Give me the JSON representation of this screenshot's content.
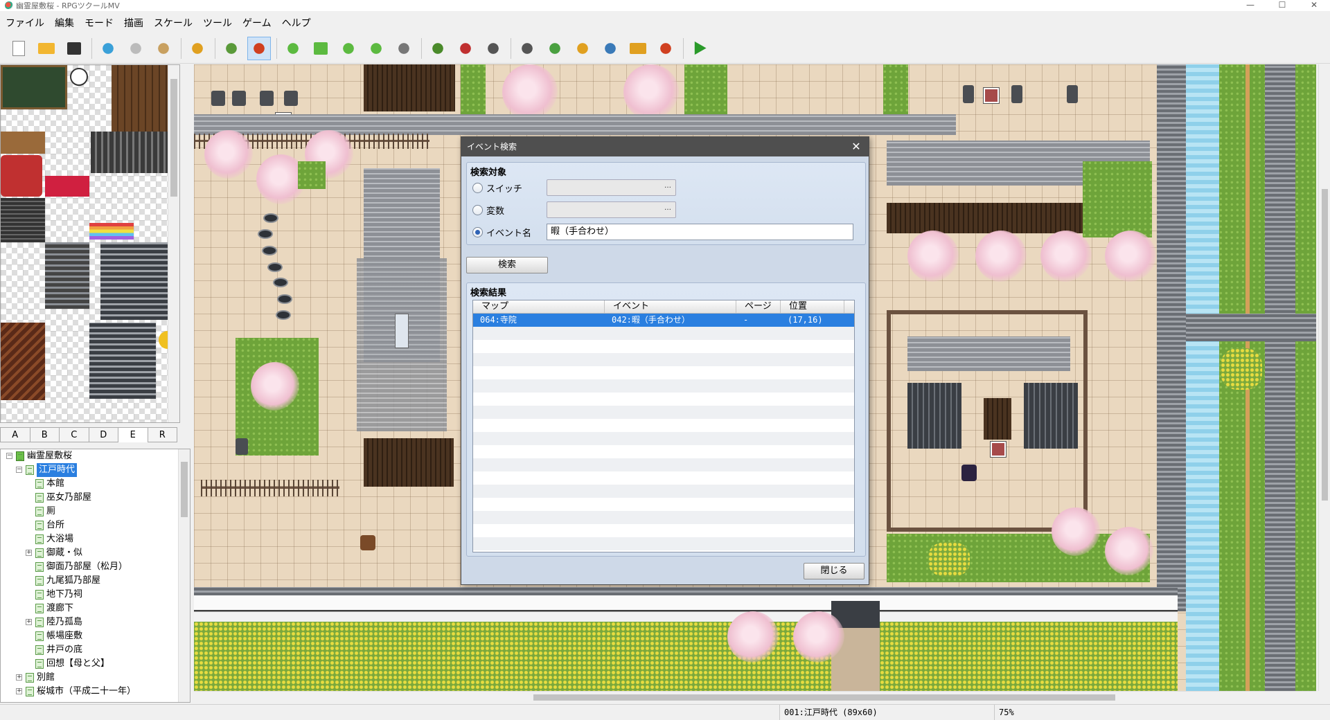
{
  "window": {
    "title": "幽霊屋敷桜 - RPGツクールMV",
    "controls": [
      "—",
      "☐",
      "✕"
    ]
  },
  "menu": [
    "ファイル",
    "編集",
    "モード",
    "描画",
    "スケール",
    "ツール",
    "ゲーム",
    "ヘルプ"
  ],
  "toolbar": [
    {
      "icon": "new-project-icon",
      "color": "#ffffff"
    },
    {
      "icon": "open-project-icon",
      "color": "#f2b630"
    },
    {
      "icon": "save-project-icon",
      "color": "#333333"
    },
    {
      "sep": true
    },
    {
      "icon": "cut-icon",
      "color": "#3aa0d8"
    },
    {
      "icon": "copy-icon",
      "color": "#bbbbbb"
    },
    {
      "icon": "paste-icon",
      "color": "#c8a060"
    },
    {
      "sep": true
    },
    {
      "icon": "undo-icon",
      "color": "#e0a020"
    },
    {
      "sep": true
    },
    {
      "icon": "map-mode-icon",
      "color": "#5a9a3a"
    },
    {
      "icon": "event-mode-icon",
      "color": "#d04020",
      "active": true
    },
    {
      "sep": true
    },
    {
      "icon": "pencil-icon",
      "color": "#5cba40"
    },
    {
      "icon": "rectangle-icon",
      "color": "#5cba40"
    },
    {
      "icon": "ellipse-icon",
      "color": "#5cba40"
    },
    {
      "icon": "flood-fill-icon",
      "color": "#5cba40"
    },
    {
      "icon": "shadow-pen-icon",
      "color": "#777777"
    },
    {
      "sep": true
    },
    {
      "icon": "zoom-in-icon",
      "color": "#4a8a2a"
    },
    {
      "icon": "zoom-out-icon",
      "color": "#c03030"
    },
    {
      "icon": "zoom-actual-icon",
      "color": "#555555"
    },
    {
      "sep": true
    },
    {
      "icon": "database-icon",
      "color": "#555555"
    },
    {
      "icon": "plugin-manager-icon",
      "color": "#4aa040"
    },
    {
      "icon": "sound-test-icon",
      "color": "#e0a020"
    },
    {
      "icon": "event-searcher-icon",
      "color": "#3a7ab8"
    },
    {
      "icon": "resource-manager-icon",
      "color": "#e0a020"
    },
    {
      "icon": "character-generator-icon",
      "color": "#d04020"
    },
    {
      "sep": true
    },
    {
      "icon": "playtest-icon",
      "color": "#2a9a2a"
    }
  ],
  "tileset_tabs": [
    "A",
    "B",
    "C",
    "D",
    "E",
    "R"
  ],
  "tileset_tab_selected": "E",
  "maptree": [
    {
      "label": "幽霊屋敷桜",
      "level": 0,
      "expander": "⊟",
      "root": true
    },
    {
      "label": "江戸時代",
      "level": 1,
      "expander": "⊟",
      "selected": true
    },
    {
      "label": "本館",
      "level": 2
    },
    {
      "label": "巫女乃部屋",
      "level": 2
    },
    {
      "label": "厠",
      "level": 2
    },
    {
      "label": "台所",
      "level": 2
    },
    {
      "label": "大浴場",
      "level": 2
    },
    {
      "label": "御蔵・似",
      "level": 2,
      "expander": "⊞"
    },
    {
      "label": "御面乃部屋（松月）",
      "level": 2
    },
    {
      "label": "九尾狐乃部屋",
      "level": 2
    },
    {
      "label": "地下乃祠",
      "level": 2
    },
    {
      "label": "渡廊下",
      "level": 2
    },
    {
      "label": "陸乃孤島",
      "level": 2,
      "expander": "⊞"
    },
    {
      "label": "帳場座敷",
      "level": 2
    },
    {
      "label": "井戸の底",
      "level": 2
    },
    {
      "label": "回想【母と父】",
      "level": 2
    },
    {
      "label": "別館",
      "level": 1,
      "expander": "⊞"
    },
    {
      "label": "桜城市（平成二十一年）",
      "level": 1,
      "expander": "⊞"
    }
  ],
  "dialog": {
    "title": "イベント検索",
    "close": "✕",
    "target_title": "検索対象",
    "options": [
      {
        "label": "スイッチ",
        "checked": false
      },
      {
        "label": "変数",
        "checked": false
      },
      {
        "label": "イベント名",
        "checked": true
      }
    ],
    "picker_button": "…",
    "event_name_value": "暇（手合わせ）",
    "search_button": "検索",
    "results_title": "検索結果",
    "columns": [
      "マップ",
      "イベント",
      "ページ",
      "位置"
    ],
    "rows": [
      {
        "map": "064:寺院",
        "event": "042:暇（手合わせ）",
        "page": "-",
        "pos": "(17,16)",
        "selected": true
      }
    ],
    "close_button": "閉じる"
  },
  "status": {
    "map": "001:江戸時代 (89x60)",
    "zoom": "75%"
  }
}
